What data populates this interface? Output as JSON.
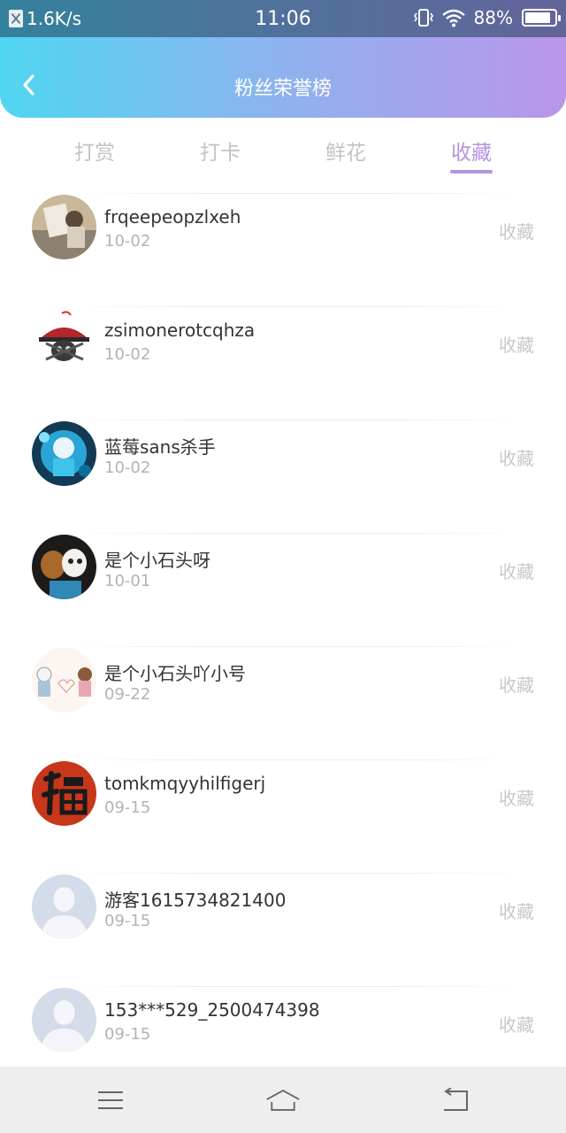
{
  "status_bar": {
    "network_speed": "1.6K/s",
    "time": "11:06",
    "battery_percent": "88%",
    "battery_level": 0.88,
    "icons": [
      "sim-icon",
      "vibrate-icon",
      "wifi-icon",
      "battery-icon"
    ]
  },
  "header": {
    "title": "粉丝荣誉榜",
    "back_icon": "back-chevron-icon"
  },
  "tabs": [
    {
      "label": "打赏",
      "active": false
    },
    {
      "label": "打卡",
      "active": false
    },
    {
      "label": "鲜花",
      "active": false
    },
    {
      "label": "收藏",
      "active": true
    }
  ],
  "colors": {
    "accent": "#b693e3",
    "header_gradient_start": "#4fd6f0",
    "header_gradient_end": "#b995e8",
    "inactive_tab": "#c3c3c3"
  },
  "list": [
    {
      "name": "frqeepeopzlxeh",
      "date": "10-02",
      "action": "收藏",
      "avatar": "photo-avatar"
    },
    {
      "name": "zsimonerotcqhza",
      "date": "10-02",
      "action": "收藏",
      "avatar": "pirate-skull-avatar"
    },
    {
      "name": "蓝莓sans杀手",
      "date": "10-02",
      "action": "收藏",
      "avatar": "blue-character-avatar"
    },
    {
      "name": "是个小石头呀",
      "date": "10-01",
      "action": "收藏",
      "avatar": "two-characters-avatar"
    },
    {
      "name": "是个小石头吖小号",
      "date": "09-22",
      "action": "收藏",
      "avatar": "couple-heart-avatar"
    },
    {
      "name": "tomkmqyyhilfigerj",
      "date": "09-15",
      "action": "收藏",
      "avatar": "fu-character-avatar"
    },
    {
      "name": "游客1615734821400",
      "date": "09-15",
      "action": "收藏",
      "avatar": "default-user-avatar"
    },
    {
      "name": "153***529_2500474398",
      "date": "09-15",
      "action": "收藏",
      "avatar": "default-user-avatar"
    }
  ],
  "nav_bar": {
    "icons": [
      "menu-icon",
      "home-icon",
      "back-icon"
    ]
  }
}
